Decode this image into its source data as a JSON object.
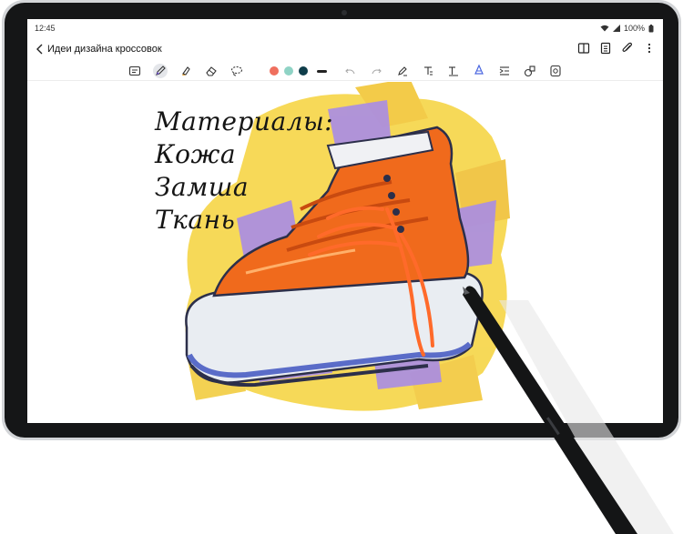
{
  "status": {
    "time": "12:45",
    "battery": "100%"
  },
  "header": {
    "title": "Идеи дизайна кроссовок",
    "actions": [
      "book-icon",
      "page-icon",
      "attach-icon",
      "more-icon"
    ]
  },
  "toolbar": {
    "tools": [
      "text-mode",
      "pen",
      "highlighter",
      "eraser",
      "lasso"
    ],
    "active_tool": "pen",
    "colors": [
      "#ef6f5e",
      "#8fd3c5",
      "#0f3d4a"
    ],
    "tools_right": [
      "undo",
      "redo",
      "pen-settings",
      "text-style",
      "text-format",
      "fill",
      "insert",
      "shapes",
      "stickers"
    ]
  },
  "note": {
    "handwriting": [
      "Материалы:",
      "Кожа",
      "Замша",
      "Ткань"
    ]
  },
  "colors": {
    "sneaker_body": "#f06a1c",
    "splash_yellow": "#f6d64a",
    "splash_purple": "#a98ce6",
    "bezel": "#151617",
    "pen": "#141516"
  }
}
